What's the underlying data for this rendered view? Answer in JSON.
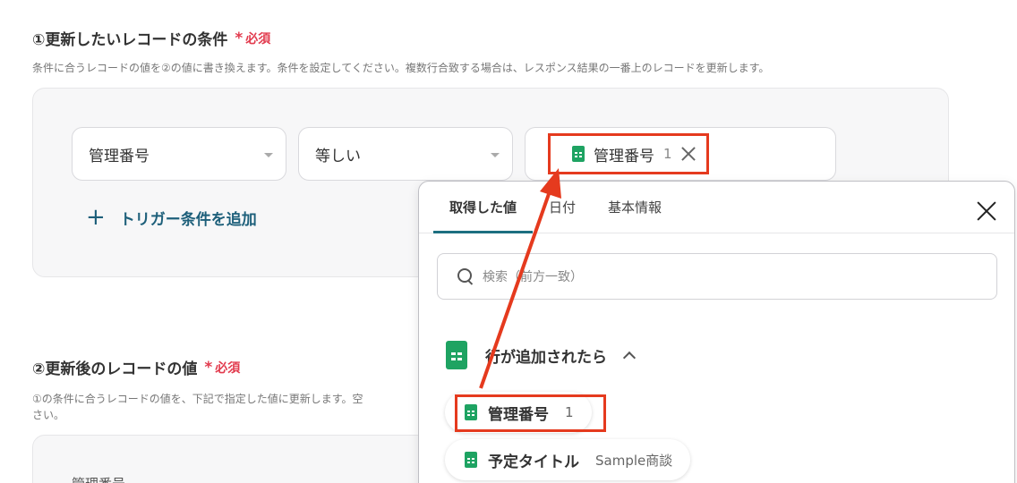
{
  "section1": {
    "title": "①更新したいレコードの条件",
    "required": "必須",
    "description": "条件に合うレコードの値を②の値に書き換えます。条件を設定してください。複数行合致する場合は、レスポンス結果の一番上のレコードを更新します。",
    "field_select": "管理番号",
    "operator_select": "等しい",
    "value_chip": {
      "label": "管理番号",
      "num": "1"
    },
    "add_condition": "トリガー条件を追加"
  },
  "section2": {
    "title": "②更新後のレコードの値",
    "required": "必須",
    "description_line1": "①の条件に合うレコードの値を、下記で指定した値に更新します。空",
    "description_line2": "さい。",
    "field_label": "管理番号"
  },
  "popup": {
    "tabs": [
      "取得した値",
      "日付",
      "基本情報"
    ],
    "active_tab": "取得した値",
    "search_placeholder": "検索（前方一致）",
    "group_title": "行が追加されたら",
    "items": [
      {
        "label": "管理番号",
        "value": "1"
      },
      {
        "label": "予定タイトル",
        "value": "Sample商談"
      }
    ]
  },
  "colors": {
    "accent": "#1d6f80",
    "required": "#e23b4e",
    "highlight": "#e53a1e",
    "sheets": "#1ea362"
  },
  "icons": [
    "sheets-icon",
    "close-icon",
    "search-icon",
    "chevron-up-icon",
    "plus-icon",
    "chevron-down-icon"
  ]
}
